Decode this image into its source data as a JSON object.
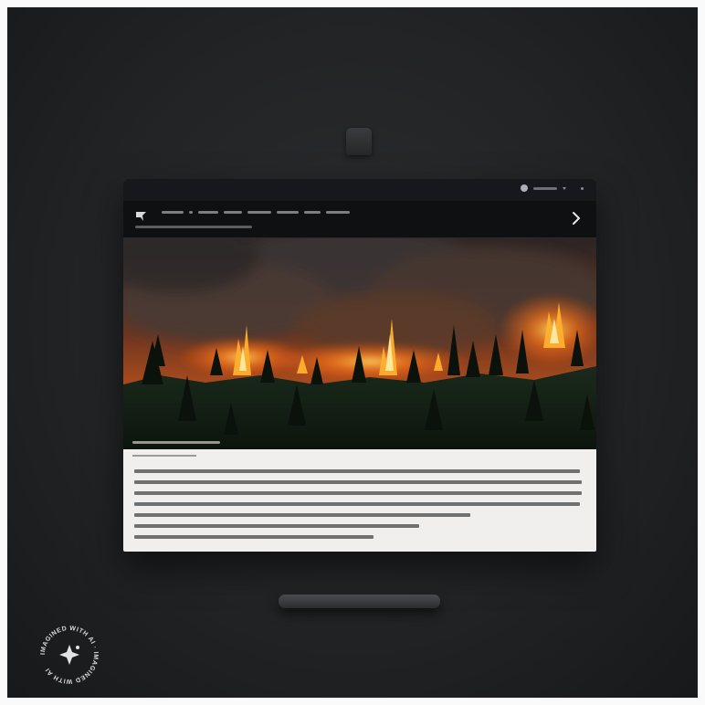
{
  "window": {
    "app_title": "",
    "account_label": ""
  },
  "nav": {
    "links": [
      "",
      "",
      "",
      "",
      "",
      "",
      "",
      ""
    ],
    "subline": ""
  },
  "hero": {
    "caption": ""
  },
  "article": {
    "meta": "",
    "paragraph_lines": [
      "",
      "",
      "",
      "",
      "",
      "",
      ""
    ]
  },
  "badge": {
    "text": "IMAGINED WITH AI · IMAGINED WITH AI"
  },
  "colors": {
    "fire": "#ff6a10",
    "smoke": "#3a3533",
    "forest": "#142016",
    "article_bg": "#f0efed",
    "page_bg": "#1e1f21"
  }
}
